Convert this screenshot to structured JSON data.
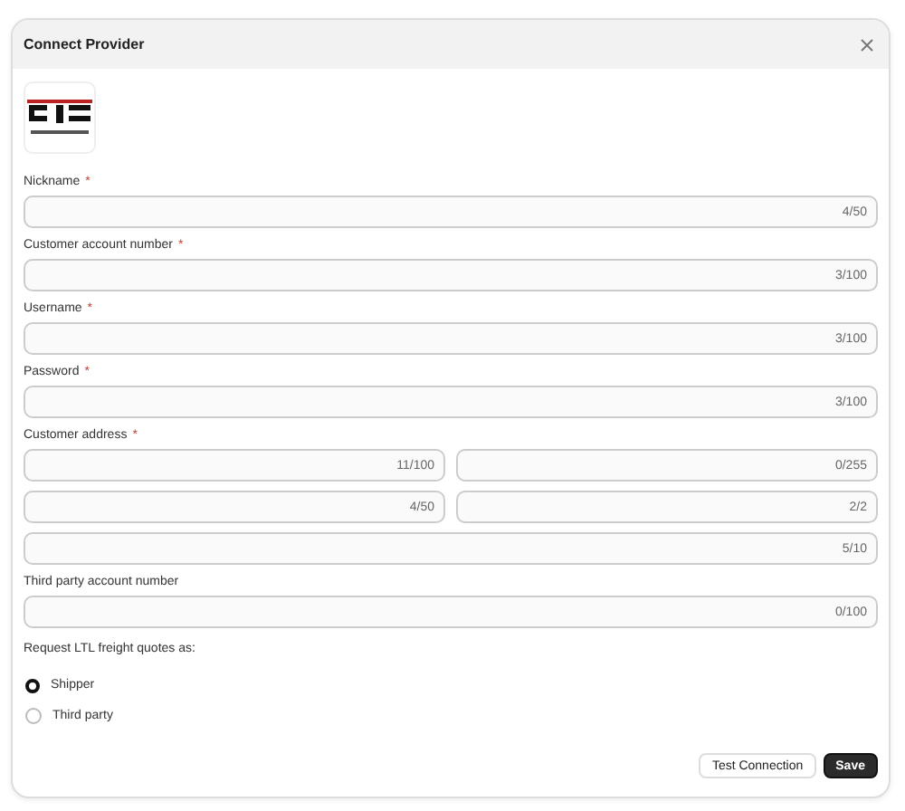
{
  "dialog": {
    "title": "Connect Provider"
  },
  "fields": [
    {
      "label": "Nickname",
      "required_mark": "*",
      "inputs": [
        {
          "counter": "4/50"
        }
      ]
    },
    {
      "label": "Customer account number",
      "required_mark": "*",
      "inputs": [
        {
          "counter": "3/100"
        }
      ]
    },
    {
      "label": "Username",
      "required_mark": "*",
      "inputs": [
        {
          "counter": "3/100"
        }
      ]
    },
    {
      "label": "Password",
      "required_mark": "*",
      "inputs": [
        {
          "counter": "3/100"
        }
      ]
    },
    {
      "label": "Customer address",
      "required_mark": "*",
      "inputs": [
        {
          "counter": "11/100"
        },
        {
          "counter": "0/255"
        },
        {
          "counter": "4/50"
        },
        {
          "counter": "2/2"
        },
        {
          "counter": "5/10"
        }
      ]
    },
    {
      "label": "Third party account number",
      "inputs": [
        {
          "counter": "0/100"
        }
      ]
    }
  ],
  "quote_as": {
    "label": "Request LTL freight quotes as:",
    "options": [
      {
        "label": "Shipper",
        "selected": true
      },
      {
        "label": "Third party",
        "selected": false
      }
    ]
  },
  "buttons": [
    {
      "label": "Test Connection",
      "kind": "secondary"
    },
    {
      "label": "Save",
      "kind": "primary"
    }
  ]
}
